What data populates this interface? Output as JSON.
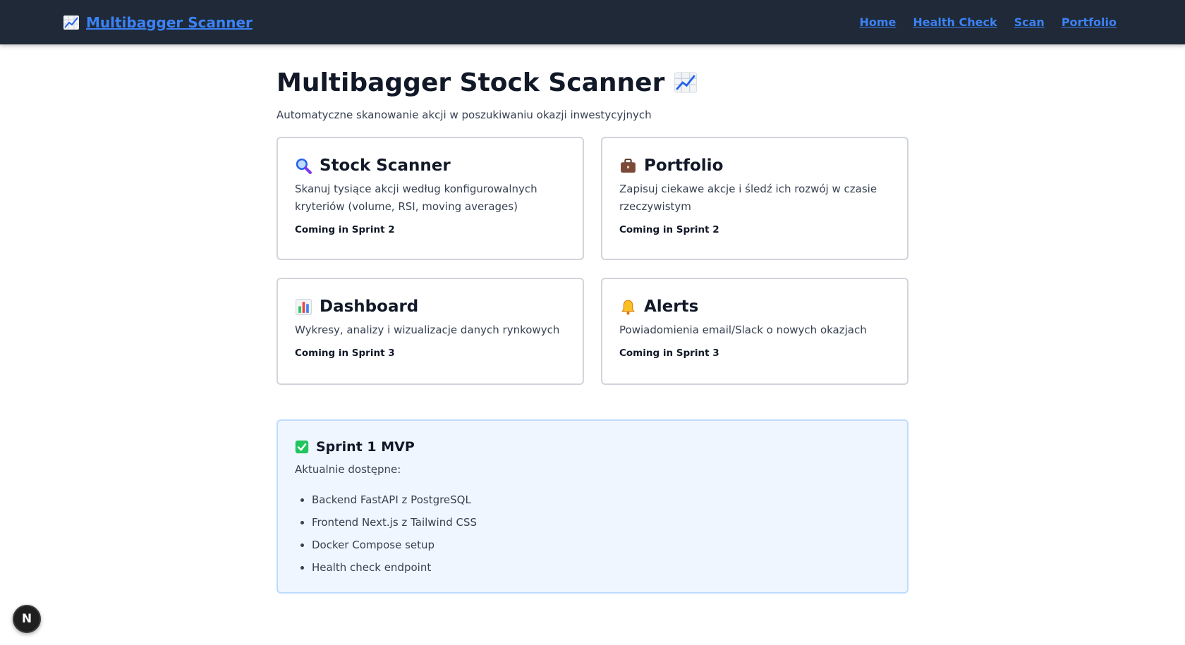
{
  "nav": {
    "brand_icon": "chart-increasing-icon",
    "brand_label": "Multibagger Scanner",
    "links": [
      "Home",
      "Health Check",
      "Scan",
      "Portfolio"
    ]
  },
  "header": {
    "title": "Multibagger Stock Scanner",
    "title_icon": "chart-increasing-icon",
    "subtitle": "Automatyczne skanowanie akcji w poszukiwaniu okazji inwestycyjnych"
  },
  "cards": [
    {
      "icon": "magnifier-icon",
      "title": "Stock Scanner",
      "description": "Skanuj tysiące akcji według konfigurowalnych kryteriów (volume, RSI, moving averages)",
      "status": "Coming in Sprint 2"
    },
    {
      "icon": "briefcase-icon",
      "title": "Portfolio",
      "description": "Zapisuj ciekawe akcje i śledź ich rozwój w czasie rzeczywistym",
      "status": "Coming in Sprint 2"
    },
    {
      "icon": "bar-chart-icon",
      "title": "Dashboard",
      "description": "Wykresy, analizy i wizualizacje danych rynkowych",
      "status": "Coming in Sprint 3"
    },
    {
      "icon": "bell-icon",
      "title": "Alerts",
      "description": "Powiadomienia email/Slack o nowych okazjach",
      "status": "Coming in Sprint 3"
    }
  ],
  "sprint": {
    "icon": "check-mark-icon",
    "title": "Sprint 1 MVP",
    "subtitle": "Aktualnie dostępne:",
    "items": [
      "Backend FastAPI z PostgreSQL",
      "Frontend Next.js z Tailwind CSS",
      "Docker Compose setup",
      "Health check endpoint"
    ]
  },
  "dev_badge": {
    "label": "N"
  },
  "colors": {
    "nav_bg": "#1f2937",
    "link": "#3b82f6",
    "card_border": "#d1d5db",
    "sprint_bg": "#eff6ff",
    "sprint_border": "#bfdbfe"
  }
}
